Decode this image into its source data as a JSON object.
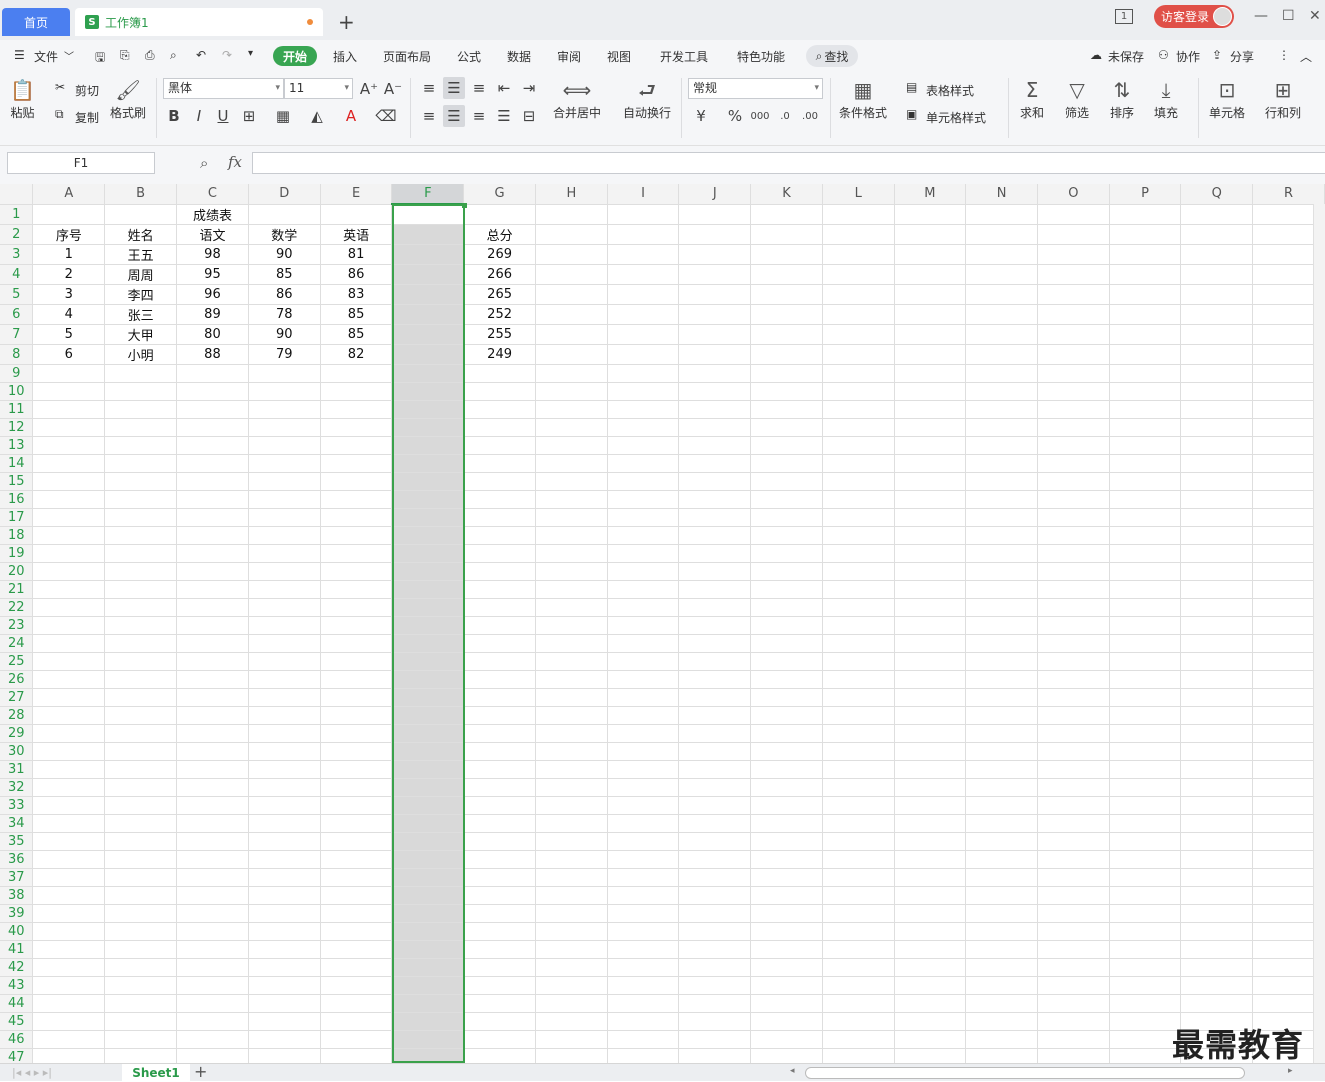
{
  "titlebar": {
    "home_tab": "首页",
    "workbook_tab": "工作簿1",
    "workbook_icon": "S",
    "new_tab": "+",
    "login": "访客登录",
    "page_badge": "1"
  },
  "menubar": {
    "file": "文件",
    "items": [
      "开始",
      "插入",
      "页面布局",
      "公式",
      "数据",
      "审阅",
      "视图",
      "开发工具",
      "特色功能"
    ],
    "search": "查找",
    "unsaved": "未保存",
    "collab": "协作",
    "share": "分享"
  },
  "ribbon": {
    "paste": "粘贴",
    "cut": "剪切",
    "copy": "复制",
    "format_painter": "格式刷",
    "font_name": "黑体",
    "font_size": "11",
    "merge_center": "合并居中",
    "wrap_text": "自动换行",
    "number_format": "常规",
    "cond_format": "条件格式",
    "table_style": "表格样式",
    "cell_style": "单元格样式",
    "sum": "求和",
    "filter": "筛选",
    "sort": "排序",
    "fill": "填充",
    "cell": "单元格",
    "row_col": "行和列"
  },
  "formula_bar": {
    "name_box": "F1",
    "fx": "fx",
    "formula": ""
  },
  "sheet": {
    "columns": [
      "A",
      "B",
      "C",
      "D",
      "E",
      "F",
      "G",
      "H",
      "I",
      "J",
      "K",
      "L",
      "M",
      "N",
      "O",
      "P",
      "Q",
      "R"
    ],
    "selected_column": "F",
    "row_count": 48,
    "title_cell": "成绩表",
    "headers": [
      "序号",
      "姓名",
      "语文",
      "数学",
      "英语"
    ],
    "total_header": "总分",
    "rows": [
      {
        "seq": "1",
        "name": "王五",
        "chinese": "98",
        "math": "90",
        "english": "81",
        "total": "269"
      },
      {
        "seq": "2",
        "name": "周周",
        "chinese": "95",
        "math": "85",
        "english": "86",
        "total": "266"
      },
      {
        "seq": "3",
        "name": "李四",
        "chinese": "96",
        "math": "86",
        "english": "83",
        "total": "265"
      },
      {
        "seq": "4",
        "name": "张三",
        "chinese": "89",
        "math": "78",
        "english": "85",
        "total": "252"
      },
      {
        "seq": "5",
        "name": "大甲",
        "chinese": "80",
        "math": "90",
        "english": "85",
        "total": "255"
      },
      {
        "seq": "6",
        "name": "小明",
        "chinese": "88",
        "math": "79",
        "english": "82",
        "total": "249"
      }
    ]
  },
  "statusbar": {
    "sheet_tab": "Sheet1",
    "add_sheet": "+"
  },
  "watermark": "最需教育",
  "colors": {
    "accent_green": "#38a552",
    "home_blue": "#4b7ff0",
    "login_red": "#e05048"
  }
}
